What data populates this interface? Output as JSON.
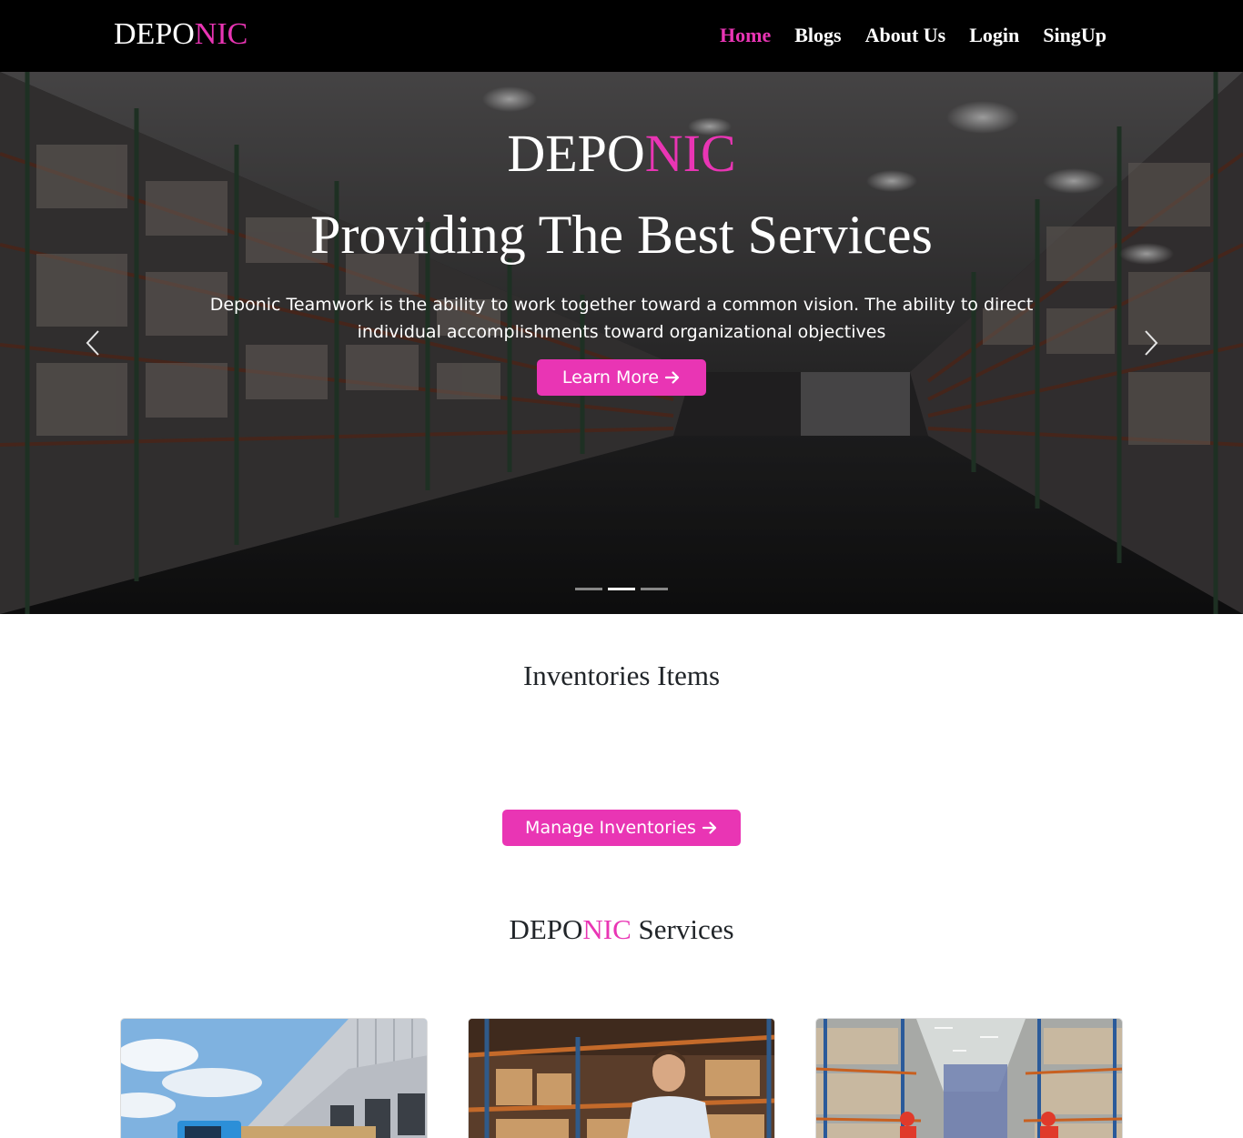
{
  "nav": {
    "brand_part1": "DEPO",
    "brand_part2": "NIC",
    "links": [
      {
        "label": "Home",
        "active": true
      },
      {
        "label": "Blogs"
      },
      {
        "label": "About Us"
      },
      {
        "label": "Login"
      },
      {
        "label": "SingUp"
      }
    ]
  },
  "hero": {
    "brand_part1": "DEPO",
    "brand_part2": "NIC",
    "title": "Providing The Best Services",
    "text": "Deponic Teamwork is the ability to work together toward a common vision. The ability to direct individual accomplishments toward organizational objectives",
    "button_label": "Learn More",
    "button_icon": "arrow-right-icon",
    "prev_icon": "chevron-left-icon",
    "next_icon": "chevron-right-icon",
    "slide_count": 3,
    "active_slide": 2
  },
  "inventory": {
    "title": "Inventories Items",
    "button_label": "Manage Inventories",
    "button_icon": "arrow-right-icon"
  },
  "services": {
    "title_part1": "DEPO",
    "title_part2": "NIC",
    "title_part3": " Services"
  },
  "colors": {
    "accent": "#e935b4",
    "navbar": "#000000"
  }
}
